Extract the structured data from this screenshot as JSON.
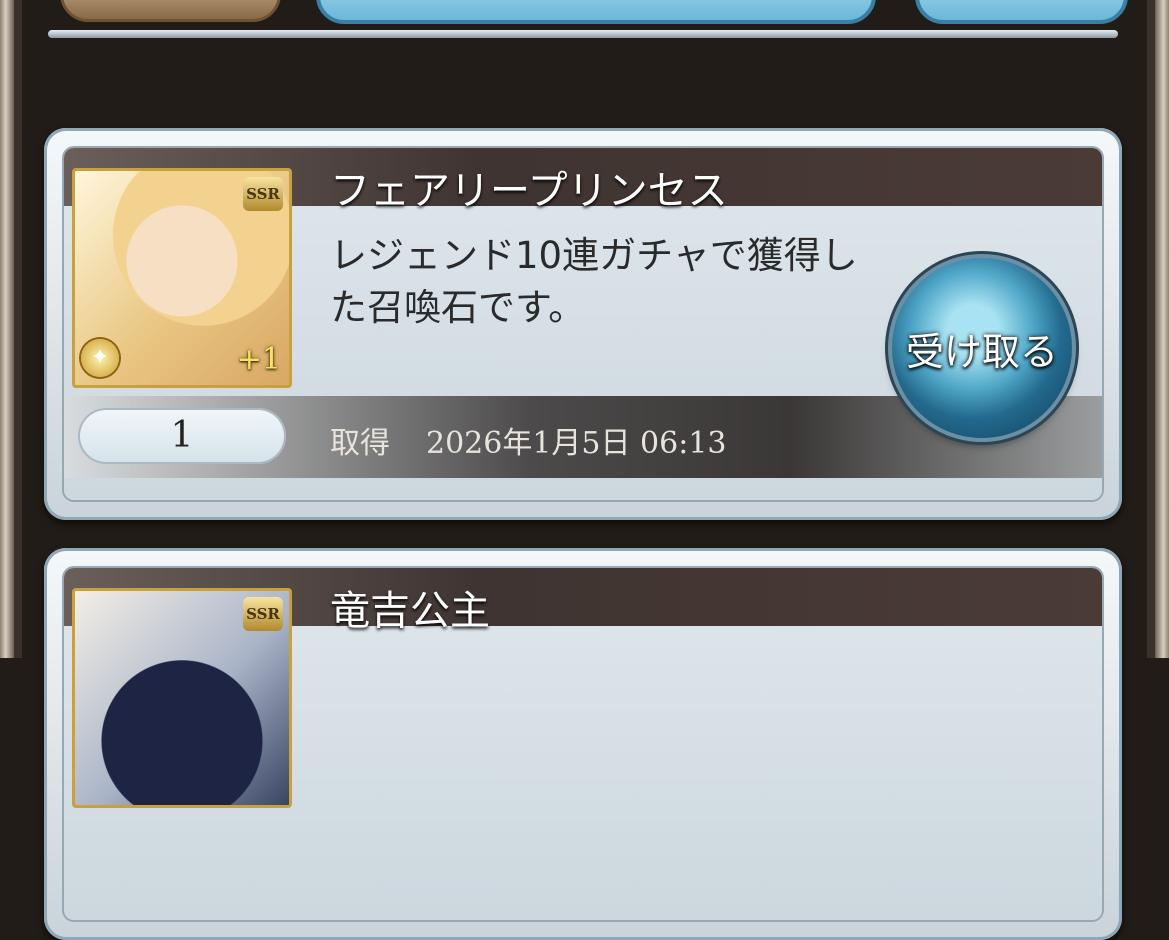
{
  "items": [
    {
      "name": "フェアリープリンセス",
      "description": "レジェンド10連ガチャで獲得した召喚石です。",
      "rarity": "SSR",
      "plus": "+1",
      "quantity": "1",
      "acquired_label": "取得",
      "acquired_date": "2026年1月5日 06:13",
      "receive_label": "受け取る"
    },
    {
      "name": "竜吉公主",
      "rarity": "SSR"
    }
  ]
}
